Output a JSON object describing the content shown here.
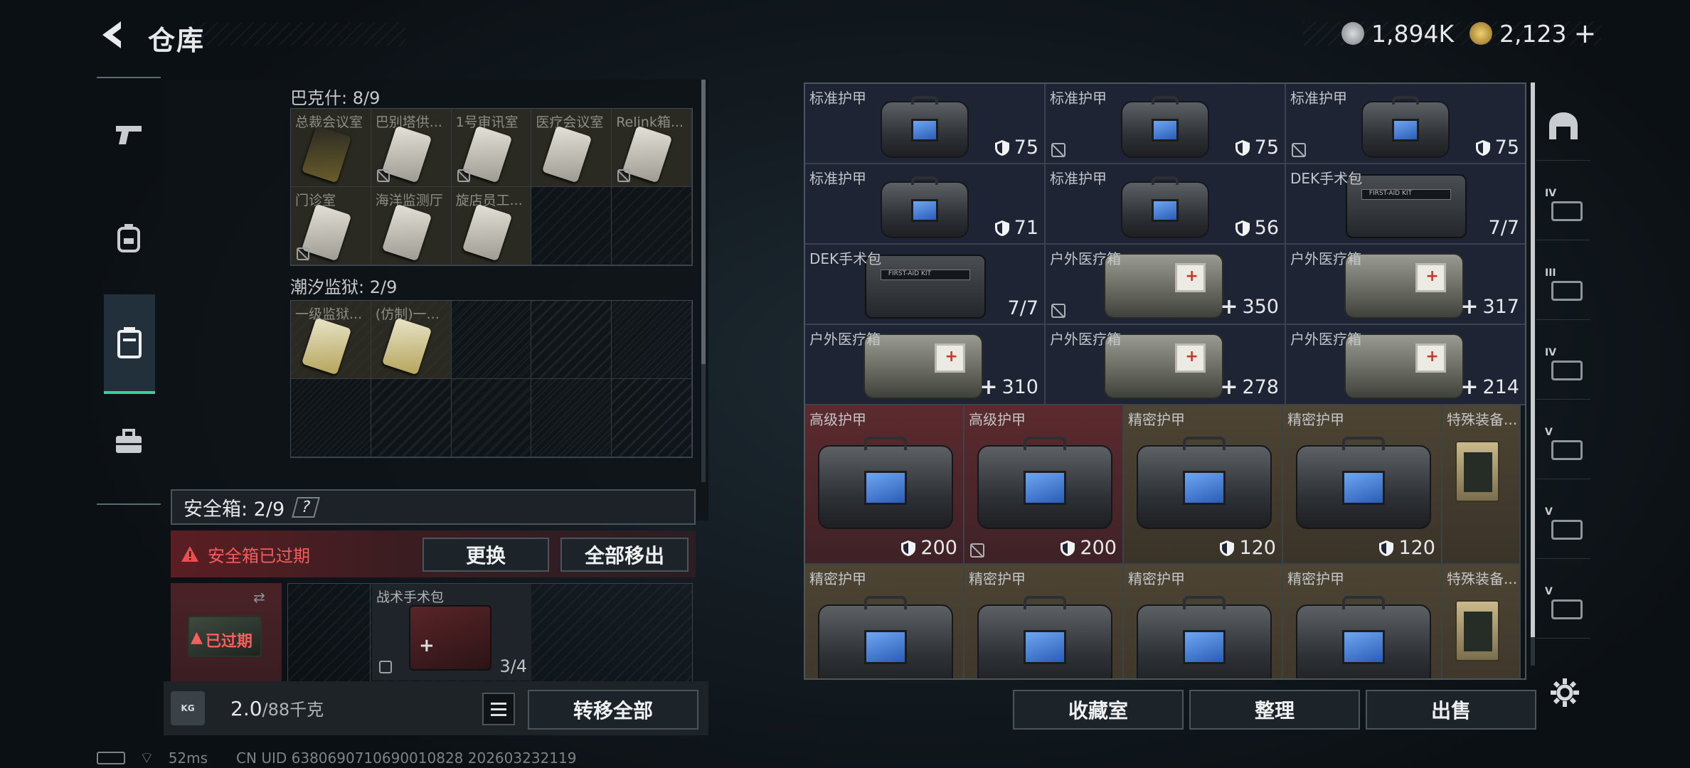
{
  "header": {
    "title": "仓库",
    "currency": [
      {
        "icon": "silver-coin-icon",
        "value": "1,894K"
      },
      {
        "icon": "gold-coin-icon",
        "value": "2,123"
      }
    ],
    "add_symbol": "+"
  },
  "sidebar": {
    "items": [
      {
        "icon": "pistol-icon"
      },
      {
        "icon": "backpack-icon"
      },
      {
        "icon": "container-icon",
        "active": true
      },
      {
        "icon": "toolbox-icon"
      }
    ]
  },
  "stash": {
    "groups": [
      {
        "label": "巴克什: 8/9",
        "keys": [
          {
            "name": "总裁会议室",
            "style": "gold",
            "unavailable": false
          },
          {
            "name": "巴别塔供...",
            "unavailable": true
          },
          {
            "name": "1号审讯室",
            "unavailable": true
          },
          {
            "name": "医疗会议室",
            "unavailable": false
          },
          {
            "name": "Relink箱...",
            "unavailable": true
          },
          {
            "name": "门诊室",
            "unavailable": true
          },
          {
            "name": "海洋监测厅",
            "unavailable": false
          },
          {
            "name": "旋店员工...",
            "unavailable": false
          }
        ]
      },
      {
        "label": "潮汐监狱: 2/9",
        "keys": [
          {
            "name": "一级监狱...",
            "style": "yel",
            "unavailable": false
          },
          {
            "name": "(仿制)一...",
            "style": "yel",
            "unavailable": false
          }
        ]
      }
    ],
    "safebox": {
      "label": "安全箱: 2/9",
      "help": "?",
      "expired_notice": "安全箱已过期",
      "expired_badge": "已过期",
      "replace_label": "更换",
      "move_all_label": "全部移出"
    },
    "tactical": {
      "name": "战术手术包",
      "uses": "3/4"
    },
    "weight": {
      "current": "2.0",
      "max": "/88千克",
      "kg_icon": "KG"
    },
    "transfer_all": "转移全部"
  },
  "inventory": {
    "rows": [
      [
        {
          "name": "标准护甲",
          "type": "armor",
          "value": "75",
          "unavailable": false
        },
        {
          "name": "标准护甲",
          "type": "armor",
          "value": "75",
          "unavailable": true
        },
        {
          "name": "标准护甲",
          "type": "armor",
          "value": "75",
          "unavailable": true
        }
      ],
      [
        {
          "name": "标准护甲",
          "type": "armor",
          "value": "71",
          "unavailable": false
        },
        {
          "name": "标准护甲",
          "type": "armor",
          "value": "56",
          "unavailable": false
        },
        {
          "name": "DEK手术包",
          "type": "surgery",
          "value": "7/7",
          "unavailable": false
        }
      ],
      [
        {
          "name": "DEK手术包",
          "type": "surgery",
          "value": "7/7",
          "unavailable": false
        },
        {
          "name": "户外医疗箱",
          "type": "medkit",
          "value": "350",
          "unavailable": true
        },
        {
          "name": "户外医疗箱",
          "type": "medkit",
          "value": "317",
          "unavailable": false
        }
      ],
      [
        {
          "name": "户外医疗箱",
          "type": "medkit",
          "value": "310",
          "unavailable": false
        },
        {
          "name": "户外医疗箱",
          "type": "medkit",
          "value": "278",
          "unavailable": false
        },
        {
          "name": "户外医疗箱",
          "type": "medkit",
          "value": "214",
          "unavailable": false
        }
      ]
    ],
    "big_rows": [
      [
        {
          "name": "高级护甲",
          "value": "200",
          "tier": "red",
          "unavailable": false
        },
        {
          "name": "高级护甲",
          "value": "200",
          "tier": "red",
          "unavailable": true
        },
        {
          "name": "精密护甲",
          "value": "120",
          "tier": "gold",
          "unavailable": false
        },
        {
          "name": "精密护甲",
          "value": "120",
          "tier": "gold",
          "unavailable": false
        },
        {
          "name": "特殊装备...",
          "value": "",
          "tier": "gold",
          "type": "book"
        }
      ],
      [
        {
          "name": "精密护甲",
          "value": "",
          "tier": "gold"
        },
        {
          "name": "精密护甲",
          "value": "",
          "tier": "gold"
        },
        {
          "name": "精密护甲",
          "value": "",
          "tier": "gold"
        },
        {
          "name": "精密护甲",
          "value": "",
          "tier": "gold"
        },
        {
          "name": "特殊装备...",
          "value": "",
          "tier": "gold",
          "type": "book"
        }
      ]
    ]
  },
  "actions": {
    "collection": "收藏室",
    "organize": "整理",
    "sell": "出售"
  },
  "right_tabs": [
    {
      "icon": "helmet-tab-icon"
    },
    {
      "icon": "rifle-iv-tab-icon",
      "text": "IV"
    },
    {
      "icon": "rifle-iii-tab-icon",
      "text": "III"
    },
    {
      "icon": "medkit-iv-tab-icon",
      "text": "IV"
    },
    {
      "icon": "armor-v-tab-icon",
      "text": "V"
    },
    {
      "icon": "armor-v2-tab-icon",
      "text": "V"
    },
    {
      "icon": "armor-v3-tab-icon",
      "text": "V"
    }
  ],
  "status": {
    "ping": "52ms",
    "uid": "CN UID 6380690710690010828 202603232119"
  },
  "colors": {
    "accent": "#3ccf9a",
    "danger": "#e04848",
    "red_tier": "#5a2a2e",
    "gold_tier": "#4b4232",
    "slot_bg": "#1e2433"
  }
}
